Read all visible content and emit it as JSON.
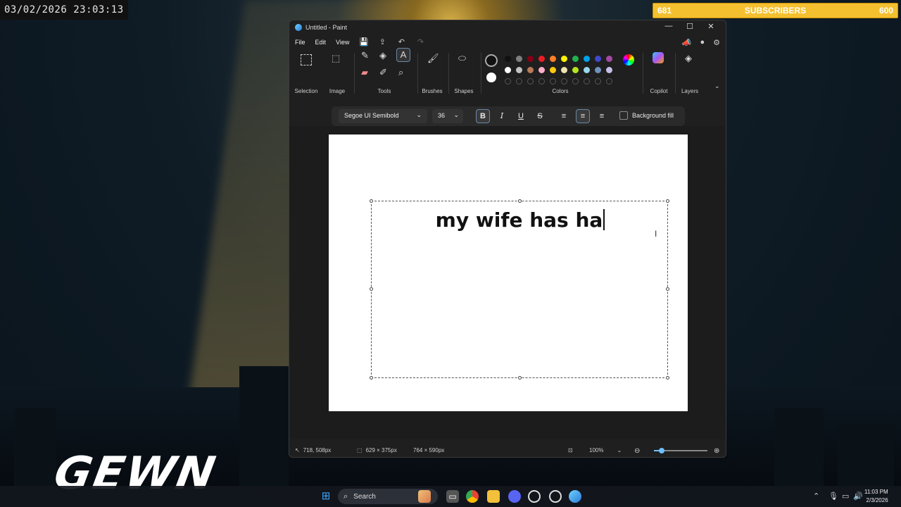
{
  "overlay": {
    "clock": "03/02/2026 23:03:13",
    "sub_goal": {
      "current": "681",
      "label": "SUBSCRIBERS",
      "target": "600",
      "progress_fraction": 1.0
    },
    "logo_text": "GEWN"
  },
  "window": {
    "title": "Untitled - Paint",
    "controls": {
      "minimize": "—",
      "maximize": "☐",
      "close": "✕"
    }
  },
  "menu": {
    "file": "File",
    "edit": "Edit",
    "view": "View"
  },
  "ribbon": {
    "groups": {
      "selection": "Selection",
      "image": "Image",
      "tools": "Tools",
      "brushes": "Brushes",
      "shapes": "Shapes",
      "colors": "Colors",
      "copilot": "Copilot",
      "layers": "Layers"
    },
    "colors_row1": [
      "#111111",
      "#7f7f7f",
      "#880015",
      "#ed1c24",
      "#ff7f27",
      "#fff200",
      "#22b14c",
      "#00a2e8",
      "#3f48cc",
      "#a349a4"
    ],
    "colors_row2": [
      "#ffffff",
      "#c3c3c3",
      "#b97a57",
      "#ffaec9",
      "#ffc90e",
      "#efe4b0",
      "#b5e61d",
      "#99d9ea",
      "#7092be",
      "#c8bfe7"
    ],
    "primary_color": "#111111",
    "secondary_color": "#ffffff"
  },
  "textbar": {
    "font": "Segoe UI Semibold",
    "size": "36",
    "bold": "B",
    "italic": "I",
    "underline": "U",
    "strike": "S",
    "background_fill": "Background fill"
  },
  "canvas": {
    "text": "my wife has ha"
  },
  "status": {
    "cursor_pos": "718, 508px",
    "selection_size": "629 × 375px",
    "canvas_size": "764 × 590px",
    "zoom": "100%",
    "zoom_fraction": 0.15
  },
  "taskbar": {
    "search": "Search",
    "time": "11:03 PM",
    "date": "2/3/2026"
  }
}
